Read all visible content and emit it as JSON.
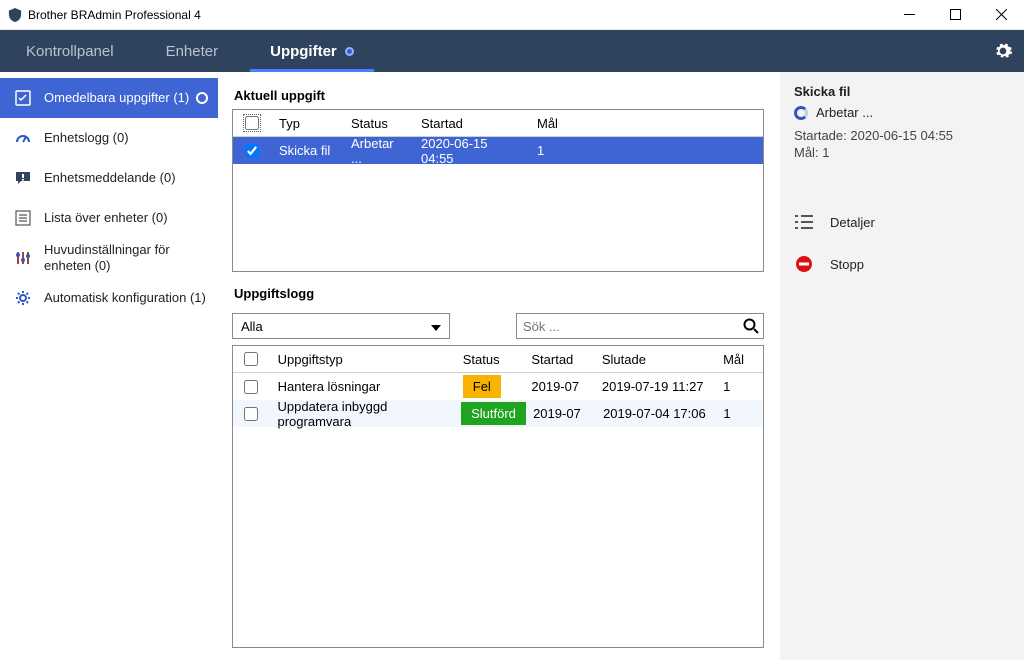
{
  "window": {
    "title": "Brother BRAdmin Professional 4"
  },
  "nav": {
    "tabs": [
      {
        "id": "dashboard",
        "label": "Kontrollpanel"
      },
      {
        "id": "devices",
        "label": "Enheter"
      },
      {
        "id": "tasks",
        "label": "Uppgifter"
      }
    ]
  },
  "sidebar": {
    "items": [
      {
        "id": "instant",
        "label": "Omedelbara uppgifter (1)"
      },
      {
        "id": "devlog",
        "label": "Enhetslogg (0)"
      },
      {
        "id": "devmsg",
        "label": "Enhetsmeddelande (0)"
      },
      {
        "id": "devlist",
        "label": "Lista över enheter (0)"
      },
      {
        "id": "mainset",
        "label": "Huvudinställningar för enheten (0)"
      },
      {
        "id": "autoconf",
        "label": "Automatisk konfiguration (1)"
      }
    ]
  },
  "current": {
    "title": "Aktuell uppgift",
    "headers": {
      "type": "Typ",
      "status": "Status",
      "started": "Startad",
      "target": "Mål"
    },
    "rows": [
      {
        "type": "Skicka fil",
        "status": "Arbetar ...",
        "started": "2020-06-15 04:55",
        "target": "1"
      }
    ]
  },
  "log": {
    "title": "Uppgiftslogg",
    "filter_value": "Alla",
    "search_placeholder": "Sök ...",
    "headers": {
      "type": "Uppgiftstyp",
      "status": "Status",
      "started": "Startad",
      "ended": "Slutade",
      "target": "Mål"
    },
    "rows": [
      {
        "type": "Hantera lösningar",
        "status_label": "Fel",
        "status_kind": "err",
        "started": "2019-07",
        "ended": "2019-07-19 11:27",
        "target": "1"
      },
      {
        "type": "Uppdatera inbyggd programvara",
        "status_label": "Slutförd",
        "status_kind": "done",
        "started": "2019-07",
        "ended": "2019-07-04 17:06",
        "target": "1"
      }
    ]
  },
  "info": {
    "title": "Skicka fil",
    "working": "Arbetar ...",
    "started_label": "Startade:",
    "started_value": "2020-06-15 04:55",
    "target_label": "Mål:",
    "target_value": "1",
    "actions": {
      "details": "Detaljer",
      "stop": "Stopp"
    }
  }
}
